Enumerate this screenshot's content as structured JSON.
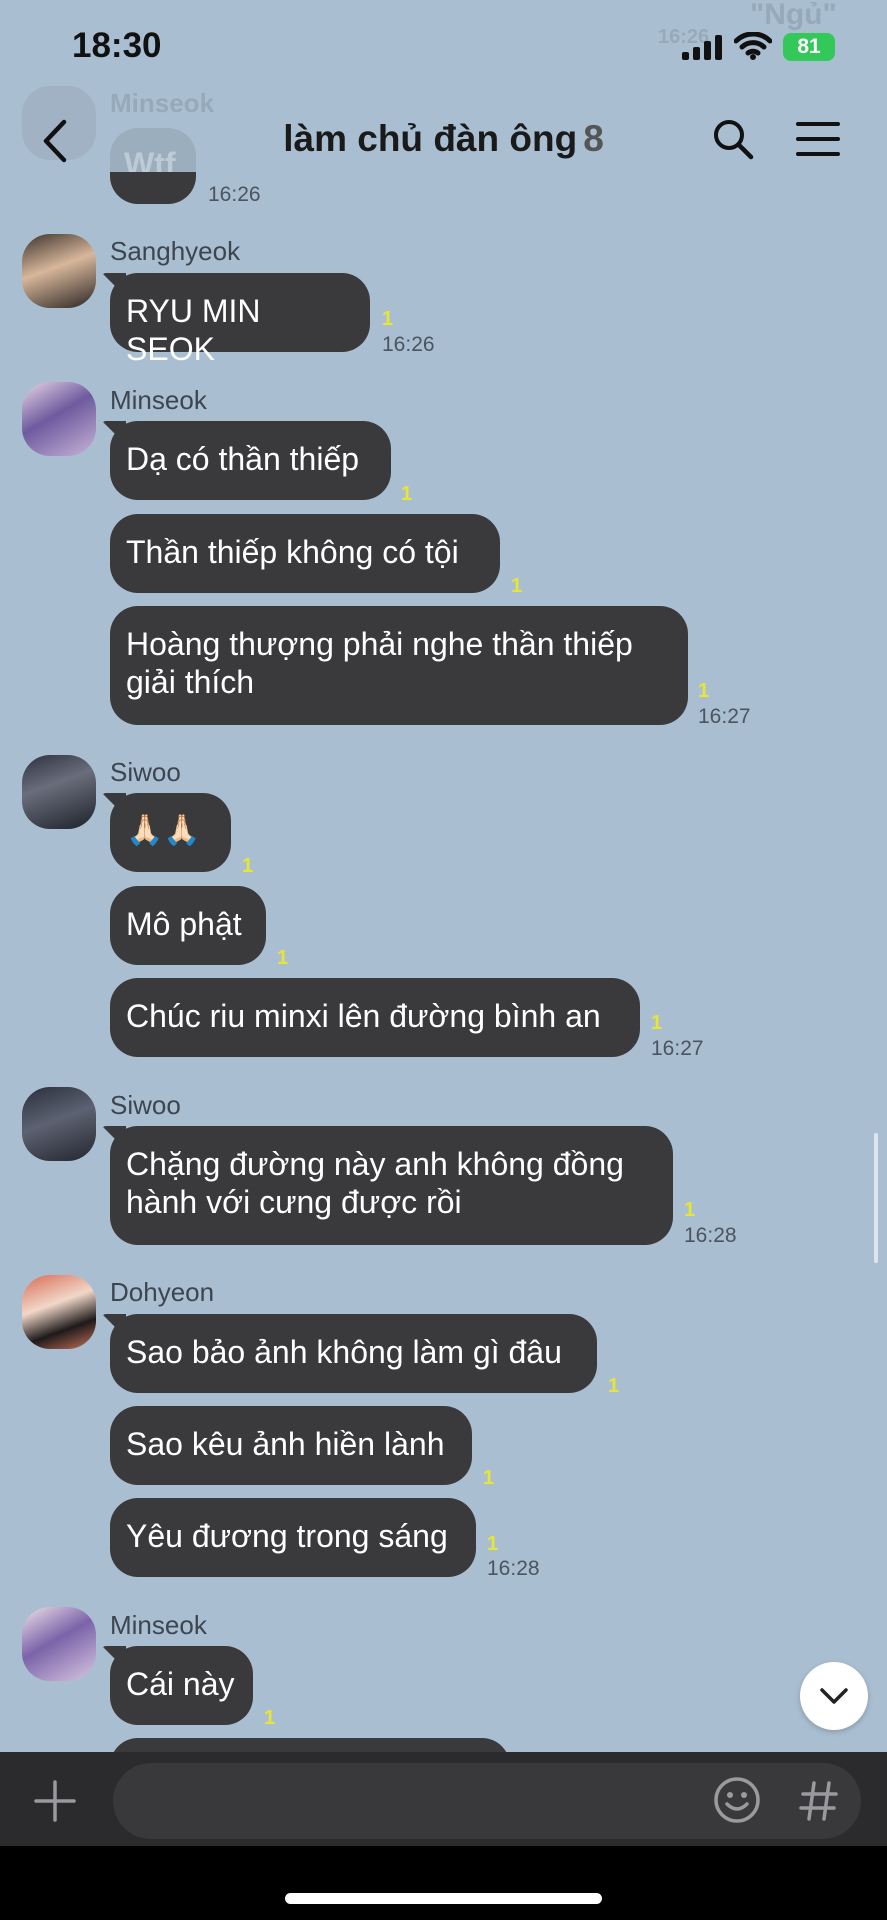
{
  "status_bar": {
    "time": "18:30",
    "battery": "81"
  },
  "ghost_overlay": {
    "text": "\"Ngủ\"",
    "sender": "Minseok",
    "message": "Wtf",
    "time": "16:26"
  },
  "header": {
    "title": "làm chủ đàn ông",
    "member_count": "8"
  },
  "messages": [
    {
      "sender": "Sanghyeok",
      "bubbles": [
        "RYU MIN SEOK"
      ],
      "unread": [
        "1"
      ],
      "time": "16:26"
    },
    {
      "sender": "Minseok",
      "bubbles": [
        "Dạ có thần thiếp",
        "Thần thiếp không có tội",
        "Hoàng thượng phải nghe thần thiếp giải thích"
      ],
      "unread": [
        "1",
        "1",
        "1"
      ],
      "time": "16:27"
    },
    {
      "sender": "Siwoo",
      "bubbles": [
        "🙏🏻🙏🏻",
        "Mô phật",
        "Chúc riu minxi lên đường bình an"
      ],
      "unread": [
        "1",
        "1",
        "1"
      ],
      "time": "16:27"
    },
    {
      "sender": "Siwoo",
      "bubbles": [
        "Chặng đường này anh không đồng hành với cưng được rồi"
      ],
      "unread": [
        "1"
      ],
      "time": "16:28"
    },
    {
      "sender": "Dohyeon",
      "bubbles": [
        "Sao bảo ảnh không làm gì đâu",
        "Sao kêu ảnh hiền lành",
        "Yêu đương trong sáng"
      ],
      "unread": [
        "1",
        "1",
        "1"
      ],
      "time": "16:28"
    },
    {
      "sender": "Minseok",
      "bubbles": [
        "Cái này"
      ],
      "unread": [
        "1"
      ],
      "time": ""
    }
  ],
  "input": {
    "placeholder": ""
  },
  "icons": {
    "back": "chevron-left-icon",
    "search": "search-icon",
    "menu": "menu-icon",
    "add": "plus-icon",
    "emoji": "emoji-icon",
    "hashtag": "hashtag-icon",
    "scroll_down": "chevron-down-icon"
  },
  "colors": {
    "background": "#a9bfd1",
    "bubble": "#3a3a3c",
    "unread": "#e8e534",
    "battery": "#34c759"
  }
}
